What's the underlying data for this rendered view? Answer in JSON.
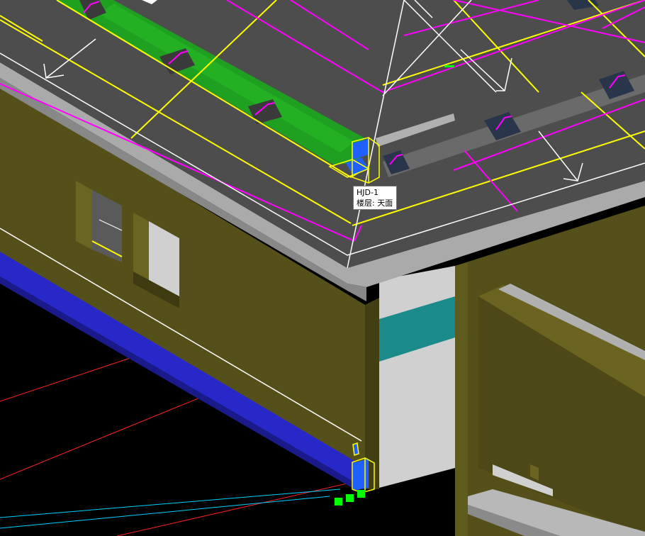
{
  "viewport": {
    "background_color": "#000000",
    "colors": {
      "roof": "#4d4d4d",
      "wall": "#55501a",
      "wall_shadow": "#3e3a12",
      "gutter": "#20a020",
      "eave": "#aaaaaa",
      "beam_blue": "#2828c8",
      "column_white": "#d0d0d0",
      "band_teal": "#1a8a8a",
      "drain": "#28354a",
      "line_yellow": "#ffff00",
      "line_magenta": "#ff00ff",
      "line_white": "#ffffff",
      "line_red": "#ff2020",
      "line_cyan": "#00d0ff",
      "grip_green": "#00ff00",
      "selected_blue": "#2060ff"
    }
  },
  "tooltip": {
    "name": "HJD-1",
    "floor": "楼层: 天面"
  }
}
